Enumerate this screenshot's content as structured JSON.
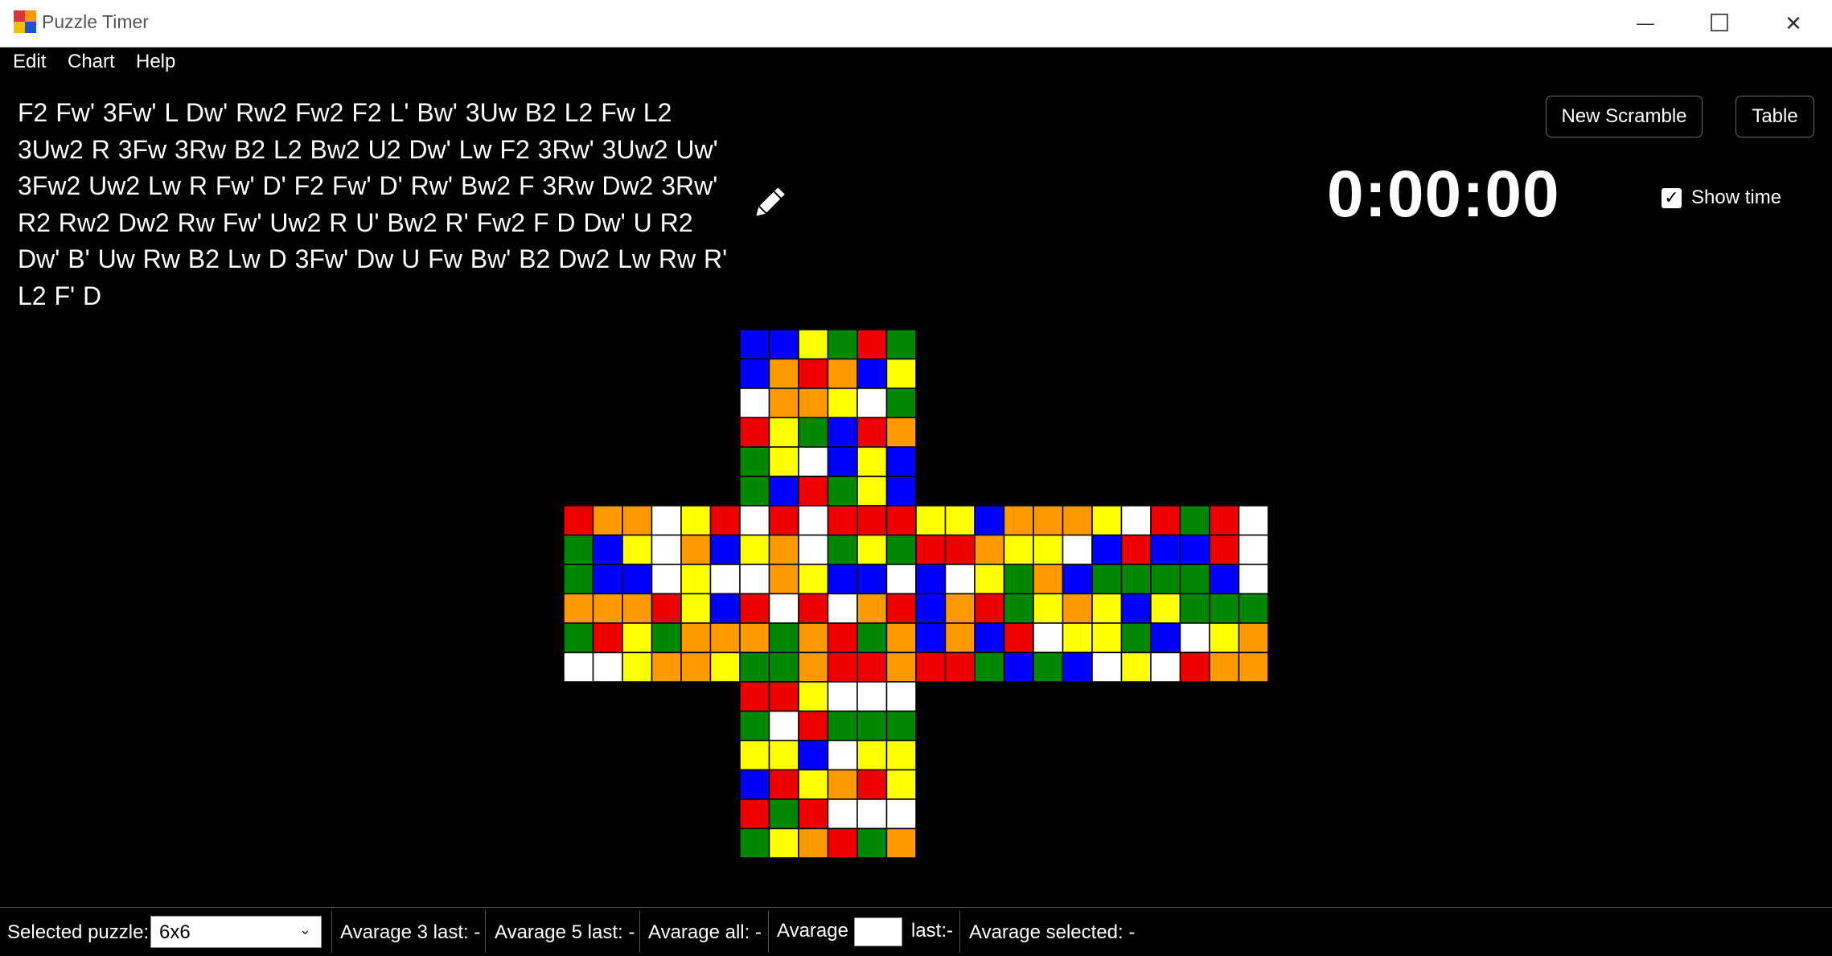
{
  "window": {
    "title": "Puzzle Timer",
    "controls": {
      "minimize": "—",
      "maximize": "☐",
      "close": "✕"
    }
  },
  "menu": {
    "items": [
      "Edit",
      "Chart",
      "Help"
    ]
  },
  "scramble": {
    "lines": [
      "F2 Fw' 3Fw' L Dw' Rw2 Fw2 F2 L' Bw' 3Uw B2 L2 Fw L2",
      "3Uw2 R 3Fw 3Rw B2 L2 Bw2 U2 Dw' Lw F2 3Rw' 3Uw2 Uw'",
      "3Fw2 Uw2 Lw R Fw' D' F2 Fw' D' Rw' Bw2 F 3Rw Dw2 3Rw'",
      "R2 Rw2 Dw2 Rw Fw' Uw2 R U' Bw2 R' Fw2 F D Dw' U R2",
      "Dw' B' Uw Rw B2 Lw D 3Fw' Dw U Fw Bw' B2 Dw2 Lw Rw R'",
      "L2 F' D"
    ],
    "edit_icon": "pencil-icon"
  },
  "buttons": {
    "new_scramble": "New Scramble",
    "table": "Table"
  },
  "timer": {
    "display": "0:00:00",
    "show_time_label": "Show time",
    "show_time_checked": true
  },
  "colors": {
    "R": "#ee0000",
    "O": "#ff9900",
    "Y": "#ffff00",
    "G": "#008800",
    "B": "#0000ff",
    "W": "#ffffff"
  },
  "cube": {
    "size": 6,
    "faces": {
      "U": [
        "BBYGRG",
        "BOROBY",
        "WOOYWG",
        "RYGBRO",
        "GYWBYB",
        "GBRGYB"
      ],
      "L": [
        "ROOWYR",
        "GBYWOB",
        "GBBWYW",
        "OOORYB",
        "GRYGOO",
        "WWYOOY"
      ],
      "F": [
        "WRWRRR",
        "YOWGYG",
        "WOYBBW",
        "RWRWOR",
        "OGORGO",
        "GGORRO"
      ],
      "R": [
        "YYBOOO",
        "RROYYW",
        "BWYGOB",
        "BORGYO",
        "BOBRWY",
        "RRGBGB"
      ],
      "B": [
        "YWRGRW",
        "BRBBRW",
        "GGGGBW",
        "YBYGGG",
        "YGBWYO",
        "WYWROO"
      ],
      "D": [
        "RRYWWW",
        "GWRGGG",
        "YYBWYY",
        "BRYORY",
        "RGRWWW",
        "GYORGO"
      ]
    }
  },
  "status": {
    "selected_puzzle_label": "Selected puzzle:",
    "selected_puzzle": "6x6",
    "avg3": "Avarage 3 last: -",
    "avg5": "Avarage 5 last: -",
    "avg_all": "Avarage all: -",
    "avg_label": "Avarage",
    "avg_input_value": "",
    "avg_last": "last:-",
    "avg_selected": "Avarage  selected:  -"
  }
}
